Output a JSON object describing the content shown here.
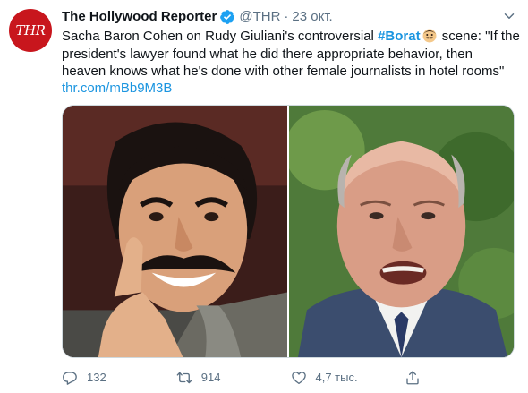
{
  "author": {
    "avatar_text": "THR",
    "name": "The Hollywood Reporter",
    "handle": "@THR",
    "separator": "·",
    "timestamp": "23 окт."
  },
  "tweet": {
    "text_part1": "Sacha Baron Cohen on Rudy Giuliani's controversial ",
    "hashtag": "#Borat",
    "text_part2": " scene:  \"If the president's lawyer found what he did there appropriate behavior, then heaven knows what he's done with other female journalists in hotel rooms\"",
    "link": "thr.com/mBb9M3B"
  },
  "media": {
    "left_image": "borat-thumbs-up",
    "right_image": "giuliani-portrait"
  },
  "actions": {
    "reply_count": "132",
    "retweet_count": "914",
    "like_count": "4,7 тыс.",
    "share_count": ""
  },
  "colors": {
    "accent": "#1b95e0",
    "muted": "#5b7083",
    "avatar_bg": "#c8161d",
    "verified": "#1da1f2"
  }
}
